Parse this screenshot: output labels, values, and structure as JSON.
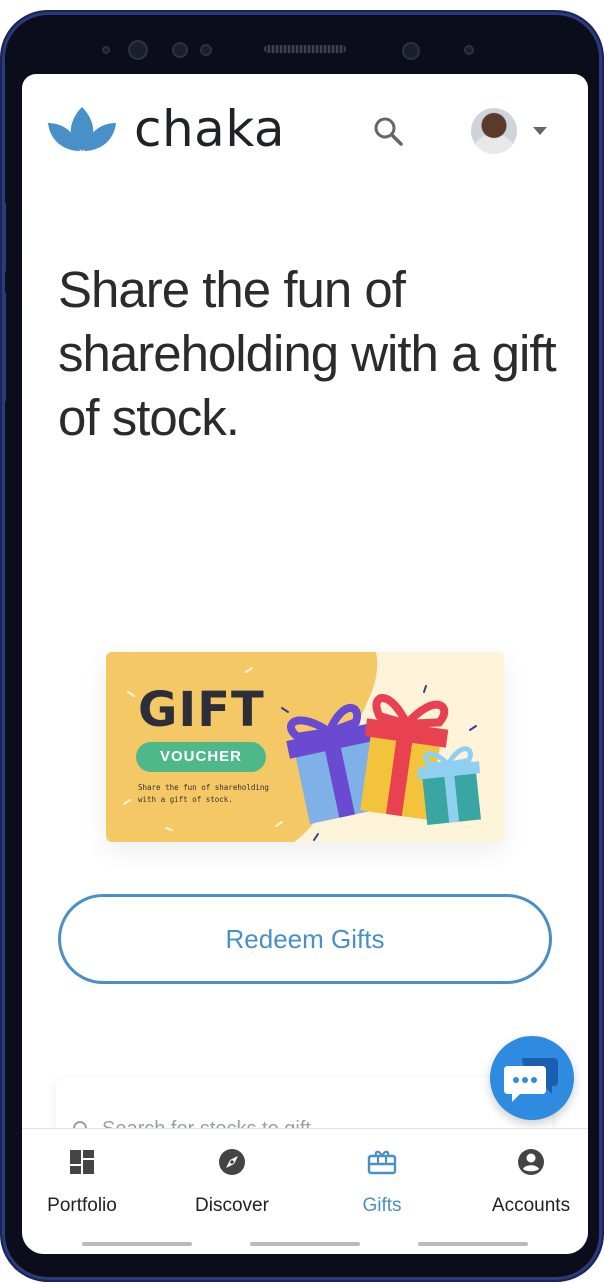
{
  "app": {
    "brand": "chaka",
    "brand_color": "#4a90c8"
  },
  "header": {
    "search_icon": "search-icon",
    "avatar_icon": "user-avatar",
    "menu_caret_icon": "caret-down-icon"
  },
  "hero": {
    "headline": "Share the fun of shareholding with a gift of stock."
  },
  "gift_card": {
    "title": "GIFT",
    "badge": "VOUCHER",
    "subtitle_line1": "Share the fun of shareholding",
    "subtitle_line2": "with a gift of stock.",
    "colors": {
      "background": "#f5c866",
      "cream": "#fdf3d9",
      "badge": "#4fb88a"
    }
  },
  "actions": {
    "redeem_label": "Redeem Gifts"
  },
  "search": {
    "placeholder": "Search for stocks to gift"
  },
  "chat": {
    "icon": "chat-bubble-icon",
    "color": "#2e8be0"
  },
  "bottom_nav": {
    "items": [
      {
        "label": "Portfolio",
        "icon": "dashboard-icon",
        "active": false
      },
      {
        "label": "Discover",
        "icon": "compass-icon",
        "active": false
      },
      {
        "label": "Gifts",
        "icon": "gift-card-icon",
        "active": true
      },
      {
        "label": "Accounts",
        "icon": "account-circle-icon",
        "active": false
      }
    ]
  }
}
